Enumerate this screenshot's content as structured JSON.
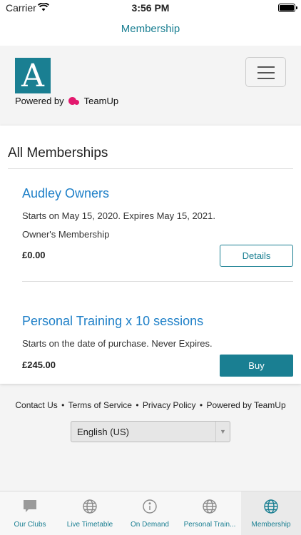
{
  "status_bar": {
    "carrier": "Carrier",
    "time": "3:56 PM"
  },
  "nav": {
    "title": "Membership"
  },
  "brand": {
    "logo_letter": "A",
    "powered_by": "Powered by",
    "teamup": "TeamUp"
  },
  "card": {
    "title": "All Memberships",
    "memberships": [
      {
        "name": "Audley Owners",
        "line1": "Starts on May 15, 2020. Expires May 15, 2021.",
        "line2": "Owner's Membership",
        "price": "£0.00",
        "action": "Details"
      },
      {
        "name": "Personal Training x 10 sessions",
        "line1": "Starts on the date of purchase. Never Expires.",
        "price": "£245.00",
        "action": "Buy"
      }
    ]
  },
  "footer": {
    "links": [
      "Contact Us",
      "Terms of Service",
      "Privacy Policy",
      "Powered by TeamUp"
    ],
    "separator": "•",
    "language": "English (US)"
  },
  "tabs": [
    {
      "label": "Our Clubs",
      "icon": "chat-bubble-icon"
    },
    {
      "label": "Live Timetable",
      "icon": "globe-icon"
    },
    {
      "label": "On Demand",
      "icon": "info-icon"
    },
    {
      "label": "Personal Train...",
      "icon": "globe-icon"
    },
    {
      "label": "Membership",
      "icon": "globe-icon",
      "active": true
    }
  ],
  "colors": {
    "accent": "#1a7f92",
    "link": "#1f80c8",
    "brand_pink": "#e3196e"
  }
}
